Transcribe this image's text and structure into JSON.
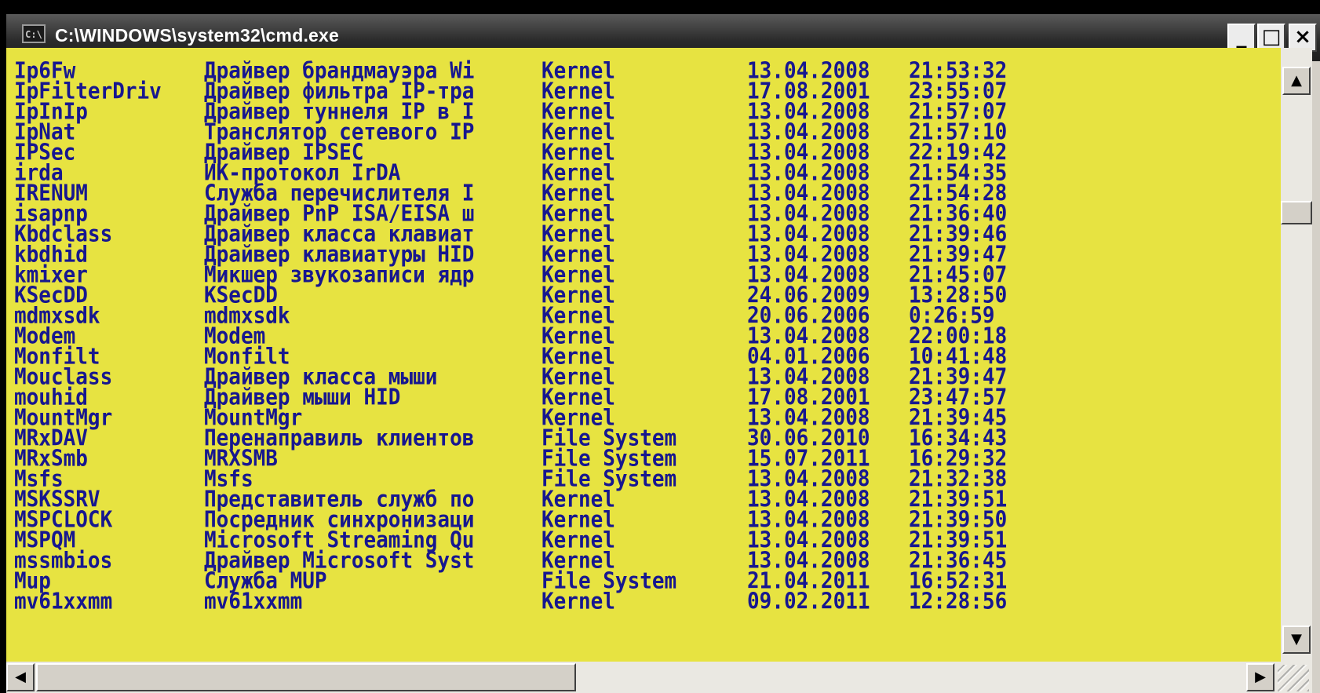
{
  "window": {
    "title": "C:\\WINDOWS\\system32\\cmd.exe",
    "icon": "C:\\",
    "icon_name": "cmd-console-icon",
    "buttons": {
      "minimize": "_",
      "maximize": "□",
      "close": "×"
    }
  },
  "colors": {
    "console_bg": "#e7e341",
    "console_text": "#17178f",
    "titlebar": "#2c2c2c"
  },
  "console": {
    "rows": [
      {
        "name": "Ip6Fw",
        "desc": "Драйвер брандмауэра Wi",
        "type": "Kernel",
        "date": "13.04.2008",
        "time": "21:53:32"
      },
      {
        "name": "IpFilterDriv",
        "desc": "Драйвер фильтра IP-тра",
        "type": "Kernel",
        "date": "17.08.2001",
        "time": "23:55:07"
      },
      {
        "name": "IpInIp",
        "desc": "Драйвер туннеля IP в I",
        "type": "Kernel",
        "date": "13.04.2008",
        "time": "21:57:07"
      },
      {
        "name": "IpNat",
        "desc": "Транслятор сетевого IP",
        "type": "Kernel",
        "date": "13.04.2008",
        "time": "21:57:10"
      },
      {
        "name": "IPSec",
        "desc": "Драйвер IPSEC",
        "type": "Kernel",
        "date": "13.04.2008",
        "time": "22:19:42"
      },
      {
        "name": "irda",
        "desc": "ИК-протокол IrDA",
        "type": "Kernel",
        "date": "13.04.2008",
        "time": "21:54:35"
      },
      {
        "name": "IRENUM",
        "desc": "Служба перечислителя I",
        "type": "Kernel",
        "date": "13.04.2008",
        "time": "21:54:28"
      },
      {
        "name": "isapnp",
        "desc": "Драйвер PnP ISA/EISA ш",
        "type": "Kernel",
        "date": "13.04.2008",
        "time": "21:36:40"
      },
      {
        "name": "Kbdclass",
        "desc": "Драйвер класса клавиат",
        "type": "Kernel",
        "date": "13.04.2008",
        "time": "21:39:46"
      },
      {
        "name": "kbdhid",
        "desc": "Драйвер клавиатуры HID",
        "type": "Kernel",
        "date": "13.04.2008",
        "time": "21:39:47"
      },
      {
        "name": "kmixer",
        "desc": "Микшер звукозаписи ядр",
        "type": "Kernel",
        "date": "13.04.2008",
        "time": "21:45:07"
      },
      {
        "name": "KSecDD",
        "desc": "KSecDD",
        "type": "Kernel",
        "date": "24.06.2009",
        "time": "13:28:50"
      },
      {
        "name": "mdmxsdk",
        "desc": "mdmxsdk",
        "type": "Kernel",
        "date": "20.06.2006",
        "time": "0:26:59"
      },
      {
        "name": "Modem",
        "desc": "Modem",
        "type": "Kernel",
        "date": "13.04.2008",
        "time": "22:00:18"
      },
      {
        "name": "Monfilt",
        "desc": "Monfilt",
        "type": "Kernel",
        "date": "04.01.2006",
        "time": "10:41:48"
      },
      {
        "name": "Mouclass",
        "desc": "Драйвер класса мыши",
        "type": "Kernel",
        "date": "13.04.2008",
        "time": "21:39:47"
      },
      {
        "name": "mouhid",
        "desc": "Драйвер мыши HID",
        "type": "Kernel",
        "date": "17.08.2001",
        "time": "23:47:57"
      },
      {
        "name": "MountMgr",
        "desc": "MountMgr",
        "type": "Kernel",
        "date": "13.04.2008",
        "time": "21:39:45"
      },
      {
        "name": "MRxDAV",
        "desc": "Перенаправиль клиентов",
        "type": "File System",
        "date": "30.06.2010",
        "time": "16:34:43"
      },
      {
        "name": "MRxSmb",
        "desc": "MRXSMB",
        "type": "File System",
        "date": "15.07.2011",
        "time": "16:29:32"
      },
      {
        "name": "Msfs",
        "desc": "Msfs",
        "type": "File System",
        "date": "13.04.2008",
        "time": "21:32:38"
      },
      {
        "name": "MSKSSRV",
        "desc": "Представитель служб по",
        "type": "Kernel",
        "date": "13.04.2008",
        "time": "21:39:51"
      },
      {
        "name": "MSPCLOCK",
        "desc": "Посредник синхронизаци",
        "type": "Kernel",
        "date": "13.04.2008",
        "time": "21:39:50"
      },
      {
        "name": "MSPQM",
        "desc": "Microsoft Streaming Qu",
        "type": "Kernel",
        "date": "13.04.2008",
        "time": "21:39:51"
      },
      {
        "name": "mssmbios",
        "desc": "Драйвер Microsoft Syst",
        "type": "Kernel",
        "date": "13.04.2008",
        "time": "21:36:45"
      },
      {
        "name": "Mup",
        "desc": "Служба MUP",
        "type": "File System",
        "date": "21.04.2011",
        "time": "16:52:31"
      },
      {
        "name": "mv61xxmm",
        "desc": "mv61xxmm",
        "type": "Kernel",
        "date": "09.02.2011",
        "time": "12:28:56"
      }
    ]
  },
  "scrollbars": {
    "up_arrow": "▲",
    "down_arrow": "▼",
    "left_arrow": "◀",
    "right_arrow": "▶"
  }
}
